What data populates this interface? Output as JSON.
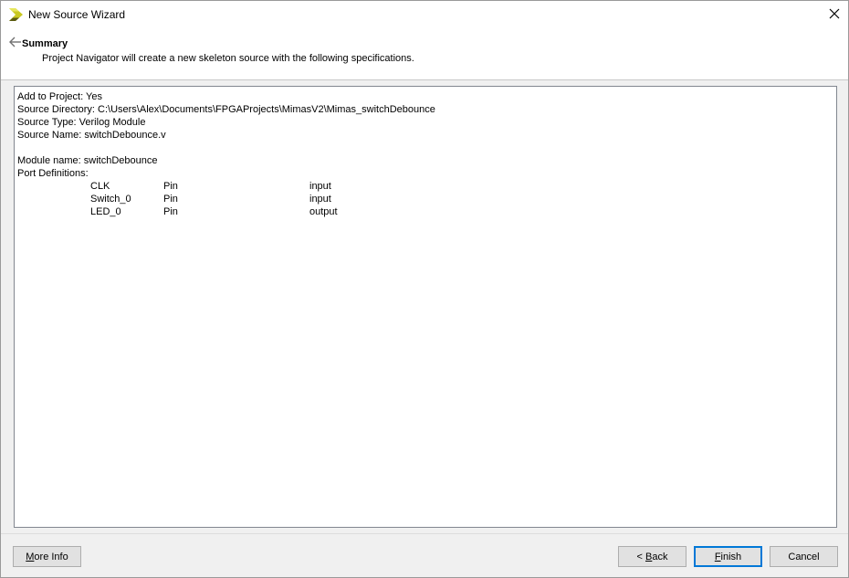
{
  "window": {
    "title": "New Source Wizard"
  },
  "header": {
    "title": "Summary",
    "description": "Project Navigator will create a new skeleton source with the following specifications."
  },
  "summary": {
    "add_to_project": "Add to Project: Yes",
    "source_directory": "Source Directory: C:\\Users\\Alex\\Documents\\FPGAProjects\\MimasV2\\Mimas_switchDebounce",
    "source_type": "Source Type: Verilog Module",
    "source_name": "Source Name: switchDebounce.v",
    "module_name": "Module name: switchDebounce",
    "port_definitions_label": "Port Definitions:",
    "ports": [
      {
        "name": "CLK",
        "type": "Pin",
        "direction": "input"
      },
      {
        "name": "Switch_0",
        "type": "Pin",
        "direction": "input"
      },
      {
        "name": "LED_0",
        "type": "Pin",
        "direction": "output"
      }
    ]
  },
  "buttons": {
    "more_info": {
      "prefix": "",
      "mnemonic": "M",
      "rest": "ore Info"
    },
    "back": {
      "prefix": "< ",
      "mnemonic": "B",
      "rest": "ack"
    },
    "finish": {
      "prefix": "",
      "mnemonic": "F",
      "rest": "inish"
    },
    "cancel": {
      "prefix": "",
      "mnemonic": "",
      "rest": "Cancel"
    }
  },
  "icons": {
    "app": "xilinx-chevron-icon",
    "close": "close-icon",
    "back": "back-arrow-icon"
  },
  "colors": {
    "app_icon_light": "#c8c820",
    "app_icon_dark": "#5a5a10",
    "default_button_border": "#0078d7"
  }
}
